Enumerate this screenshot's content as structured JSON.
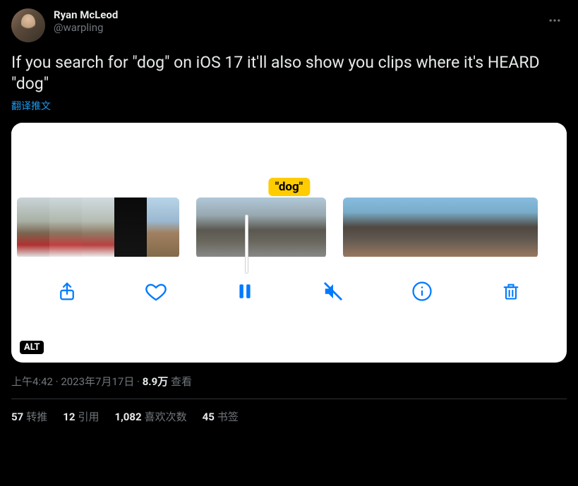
{
  "author": {
    "display_name": "Ryan McLeod",
    "handle": "@warpling"
  },
  "tweet_text": "If you search for \"dog\" on iOS 17 it'll also show you clips where it's HEARD \"dog\"",
  "translate_label": "翻译推文",
  "media": {
    "search_badge": "\"dog\"",
    "alt_label": "ALT"
  },
  "meta": {
    "time": "上午4:42",
    "date": "2023年7月17日",
    "views_count": "8.9万",
    "views_label": "查看",
    "separator": " · "
  },
  "stats": {
    "retweets_count": "57",
    "retweets_label": "转推",
    "quotes_count": "12",
    "quotes_label": "引用",
    "likes_count": "1,082",
    "likes_label": "喜欢次数",
    "bookmarks_count": "45",
    "bookmarks_label": "书签"
  }
}
